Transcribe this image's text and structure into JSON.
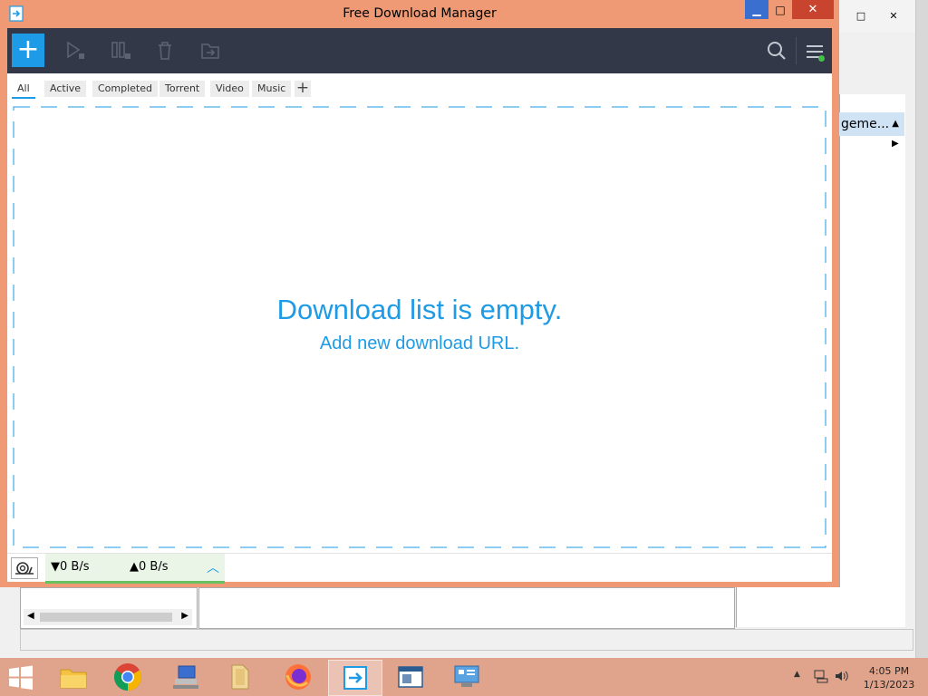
{
  "window": {
    "title": "Free Download Manager",
    "minimize": "▁",
    "maximize": "□",
    "close": "✕"
  },
  "toolbar": {
    "add_label": "+",
    "buttons": [
      "start-icon",
      "pause-icon",
      "delete-icon",
      "move-icon"
    ]
  },
  "tabs": [
    {
      "label": "All",
      "active": true
    },
    {
      "label": "Active",
      "active": false
    },
    {
      "label": "Completed",
      "active": false
    },
    {
      "label": "Torrent",
      "active": false
    },
    {
      "label": "Video",
      "active": false
    },
    {
      "label": "Music",
      "active": false
    }
  ],
  "tab_add": "+",
  "empty": {
    "title": "Download list is empty.",
    "subtitle": "Add new download URL."
  },
  "status": {
    "download_speed": "▼0 B/s",
    "upload_speed": "▲0 B/s",
    "expand": "︿"
  },
  "background_window": {
    "column_header": "geme...",
    "sort_arrow": "▲",
    "expand_arrow": "▶",
    "maximize": "□",
    "close": "✕"
  },
  "taskbar": {
    "time": "4:05 PM",
    "date": "1/13/2023"
  },
  "colors": {
    "accent": "#1e9be6",
    "window_frame": "#ef9a74",
    "toolbar": "#323847",
    "speed_ok": "#67c15e"
  }
}
